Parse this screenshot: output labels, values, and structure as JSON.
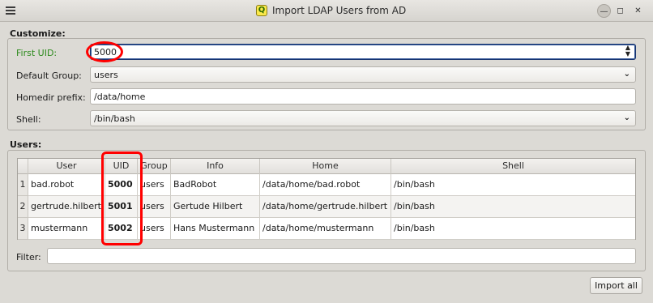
{
  "window": {
    "title": "Import LDAP Users from AD",
    "app_icon_letter": "Q"
  },
  "customize": {
    "heading": "Customize:",
    "first_uid": {
      "label": "First UID:",
      "value": "5000"
    },
    "default_group": {
      "label": "Default Group:",
      "value": "users"
    },
    "homedir_prefix": {
      "label": "Homedir prefix:",
      "value": "/data/home"
    },
    "shell": {
      "label": "Shell:",
      "value": "/bin/bash"
    }
  },
  "users": {
    "heading": "Users:",
    "columns": [
      "User",
      "UID",
      "Group",
      "Info",
      "Home",
      "Shell"
    ],
    "rows": [
      {
        "num": "1",
        "user": "bad.robot",
        "uid": "5000",
        "group": "users",
        "info": "BadRobot",
        "home": "/data/home/bad.robot",
        "shell": "/bin/bash"
      },
      {
        "num": "2",
        "user": "gertrude.hilbert",
        "uid": "5001",
        "group": "users",
        "info": "Gertude Hilbert",
        "home": "/data/home/gertrude.hilbert",
        "shell": "/bin/bash"
      },
      {
        "num": "3",
        "user": "mustermann",
        "uid": "5002",
        "group": "users",
        "info": "Hans Mustermann",
        "home": "/data/home/mustermann",
        "shell": "/bin/bash"
      }
    ]
  },
  "filter": {
    "label": "Filter:",
    "value": ""
  },
  "actions": {
    "import_all": "Import all"
  }
}
